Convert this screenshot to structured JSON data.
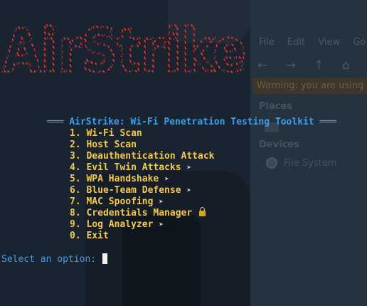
{
  "background": {
    "toolbar_menus": "File Edit View Go",
    "nav_icons": "← → ↑ ⌂",
    "warning_text": "Warning: you are using the root account",
    "places_heading": "Places",
    "devices_heading": "Devices",
    "device_label": "File System"
  },
  "banner": {
    "text": "AirStrike",
    "stroke_color": "#e0352b"
  },
  "menu": {
    "title": "AirStrike: Wi-Fi Penetration Testing Toolkit",
    "title_decoration": "═══",
    "items": [
      {
        "label": "1. Wi-Fi Scan",
        "has_submenu": false
      },
      {
        "label": "2. Host Scan",
        "has_submenu": false
      },
      {
        "label": "3. Deauthentication Attack",
        "has_submenu": false
      },
      {
        "label": "4. Evil Twin Attacks",
        "has_submenu": true,
        "arrow": "➤"
      },
      {
        "label": "5. WPA Handshake",
        "has_submenu": true,
        "arrow": "➤"
      },
      {
        "label": "6. Blue-Team Defense",
        "has_submenu": true,
        "arrow": "➤"
      },
      {
        "label": "7. MAC Spoofing",
        "has_submenu": true,
        "arrow": "➤"
      },
      {
        "label": "8. Credentials Manager",
        "has_submenu": false,
        "icon": "lock-key-icon"
      },
      {
        "label": "9. Log Analyzer",
        "has_submenu": true,
        "arrow": "➤"
      },
      {
        "label": "0. Exit",
        "has_submenu": false
      }
    ]
  },
  "prompt": {
    "text": "Select an option:"
  },
  "colors": {
    "title": "#3d9ee8",
    "items": "#f2c94c",
    "prompt": "#3d9ee8",
    "banner": "#e0352b"
  }
}
